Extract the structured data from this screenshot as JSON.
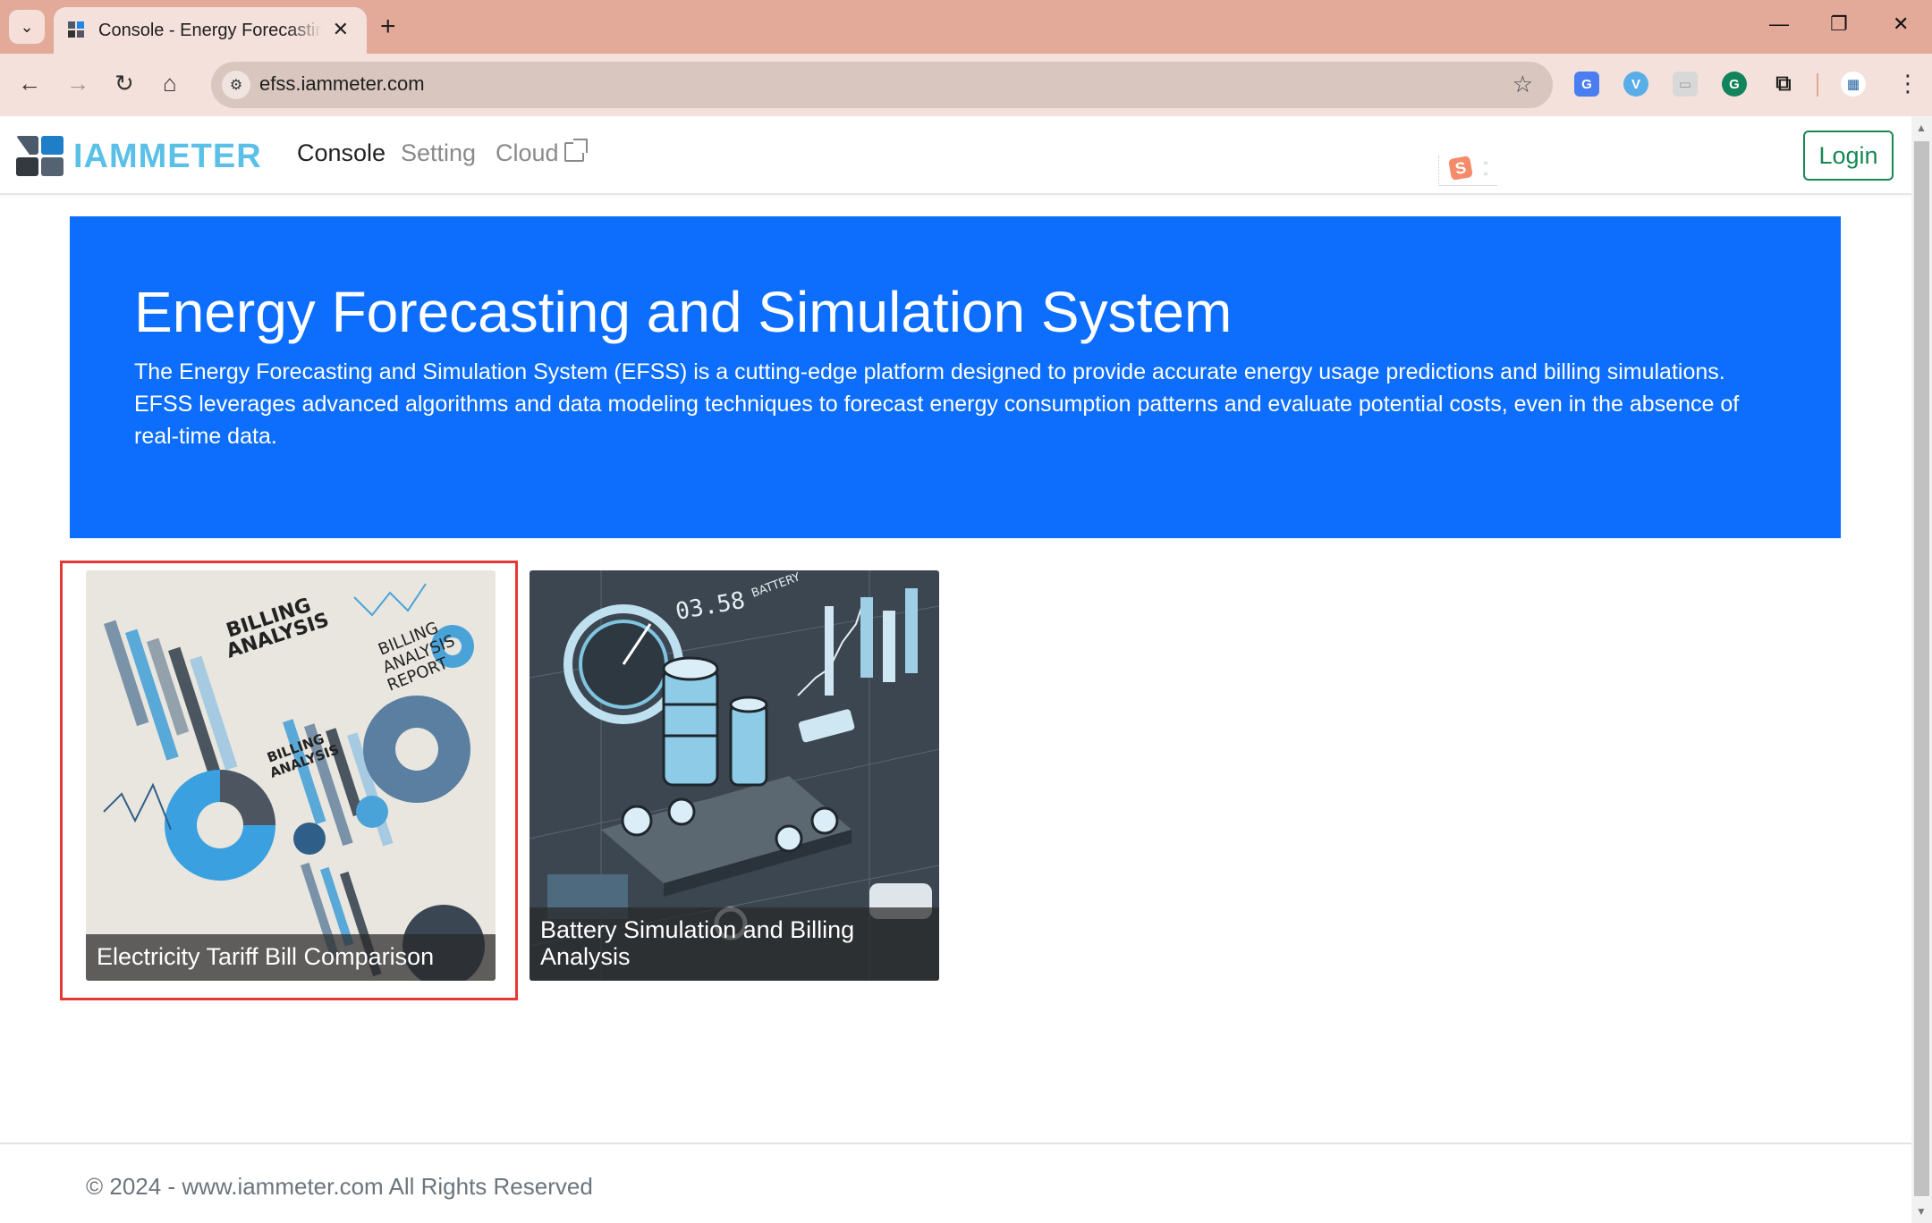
{
  "browser": {
    "tab_title": "Console - Energy Forecasting and Simulation System",
    "tab_close": "✕",
    "new_tab": "+",
    "tab_dropdown": "⌄",
    "url": "efss.iammeter.com",
    "window_controls": {
      "minimize": "—",
      "restore": "❐",
      "close": "✕"
    },
    "nav_icons": {
      "back": "←",
      "forward": "→",
      "reload": "↻",
      "home": "⌂",
      "site_info": "⚙",
      "bookmark": "☆",
      "menu": "⋮"
    },
    "extensions": [
      {
        "name": "google-translate",
        "glyph": "G",
        "color": "#4a7ef0"
      },
      {
        "name": "vimeo-like",
        "glyph": "V",
        "color": "#5aaee8"
      },
      {
        "name": "screenshot",
        "glyph": "▭",
        "color": "#d8d8d8"
      },
      {
        "name": "grammarly",
        "glyph": "G",
        "color": "#11845b"
      },
      {
        "name": "extensions-puzzle",
        "glyph": "⧉",
        "color": "#f5e1db"
      },
      {
        "name": "iammeter-ext",
        "glyph": "▦",
        "color": "#ffffff"
      }
    ]
  },
  "navbar": {
    "brand": "IAMMETER",
    "links": [
      {
        "label": "Console",
        "active": true
      },
      {
        "label": "Setting",
        "active": false
      },
      {
        "label": "Cloud",
        "active": false,
        "external": true
      }
    ],
    "login_label": "Login",
    "ime_badge": "S"
  },
  "hero": {
    "title": "Energy Forecasting and Simulation System",
    "description": "The Energy Forecasting and Simulation System (EFSS) is a cutting-edge platform designed to provide accurate energy usage predictions and billing simulations. EFSS leverages advanced algorithms and data modeling techniques to forecast energy consumption patterns and evaluate potential costs, even in the absence of real-time data.",
    "background_color": "#0d6efd"
  },
  "cards": [
    {
      "title": "Electricity Tariff Bill Comparison",
      "selected": true,
      "image_theme": "billing-analysis-charts"
    },
    {
      "title": "Battery Simulation and Billing Analysis",
      "selected": false,
      "image_theme": "battery-dashboard"
    }
  ],
  "footer": {
    "text": "© 2024 - www.iammeter.com All Rights Reserved"
  },
  "colors": {
    "accent": "#0d6efd",
    "login": "#198754",
    "brand": "#5bc0e8",
    "selection": "#e53935",
    "chrome": "#e3aa99"
  }
}
